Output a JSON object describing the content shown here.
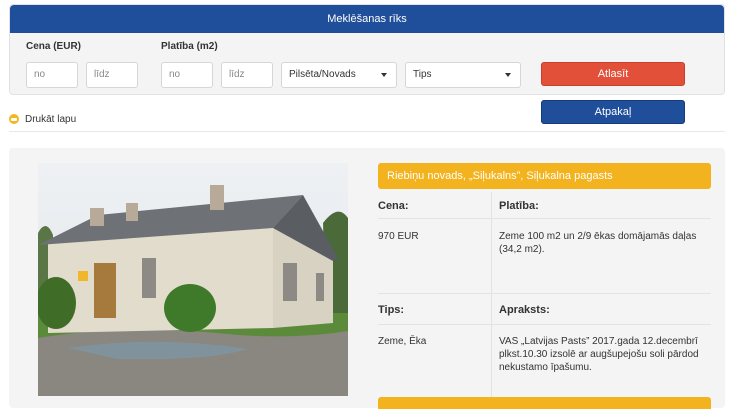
{
  "search": {
    "header": "Meklēšanas rīks",
    "price_label": "Cena (EUR)",
    "area_label": "Platība (m2)",
    "price_from_placeholder": "no",
    "price_to_placeholder": "līdz",
    "area_from_placeholder": "no",
    "area_to_placeholder": "līdz",
    "city_select": "Pilsēta/Novads",
    "type_select": "Tips",
    "search_button": "Atlasīt",
    "back_button": "Atpakaļ"
  },
  "print_label": "Drukāt lapu",
  "listing": {
    "title": "Riebiņu novads, „Siļukalns”, Siļukalna pagasts",
    "price_header": "Cena:",
    "area_header": "Platība:",
    "price_value": "970 EUR",
    "area_value": "Zeme 100 m2 un 2/9 ēkas domājamās daļas (34,2 m2).",
    "type_header": "Tips:",
    "description_header": "Apraksts:",
    "type_value": "Zeme, Ēka",
    "description_value": "VAS „Latvijas Pasts” 2017.gada 12.decembrī plkst.10.30 izsolē ar augšupejošu soli pārdod nekustamo īpašumu."
  },
  "colors": {
    "primary_blue": "#1f4e9a",
    "search_red": "#e2503a",
    "accent_yellow": "#f2b31e"
  }
}
